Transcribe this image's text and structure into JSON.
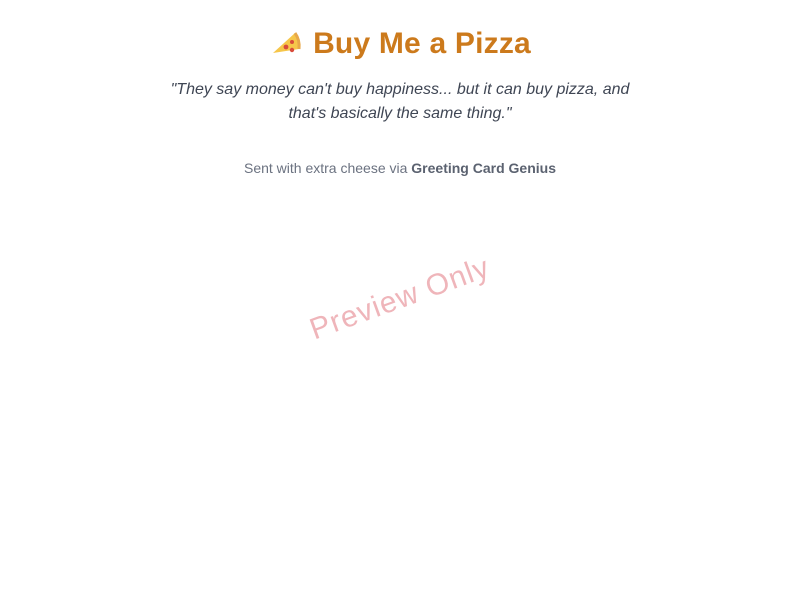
{
  "card": {
    "icon": "pizza-slice-icon",
    "title": "Buy Me a Pizza",
    "quote": "\"They say money can't buy happiness... but it can buy pizza, and that's basically the same thing.\"",
    "sender_prefix": "Sent with extra cheese via ",
    "sender_brand": "Greeting Card Genius"
  },
  "watermark": {
    "text": "Preview Only"
  },
  "colors": {
    "title": "#cc7a1c",
    "quote": "#3f4654",
    "sender": "#6b7280",
    "watermark": "#e27882"
  }
}
